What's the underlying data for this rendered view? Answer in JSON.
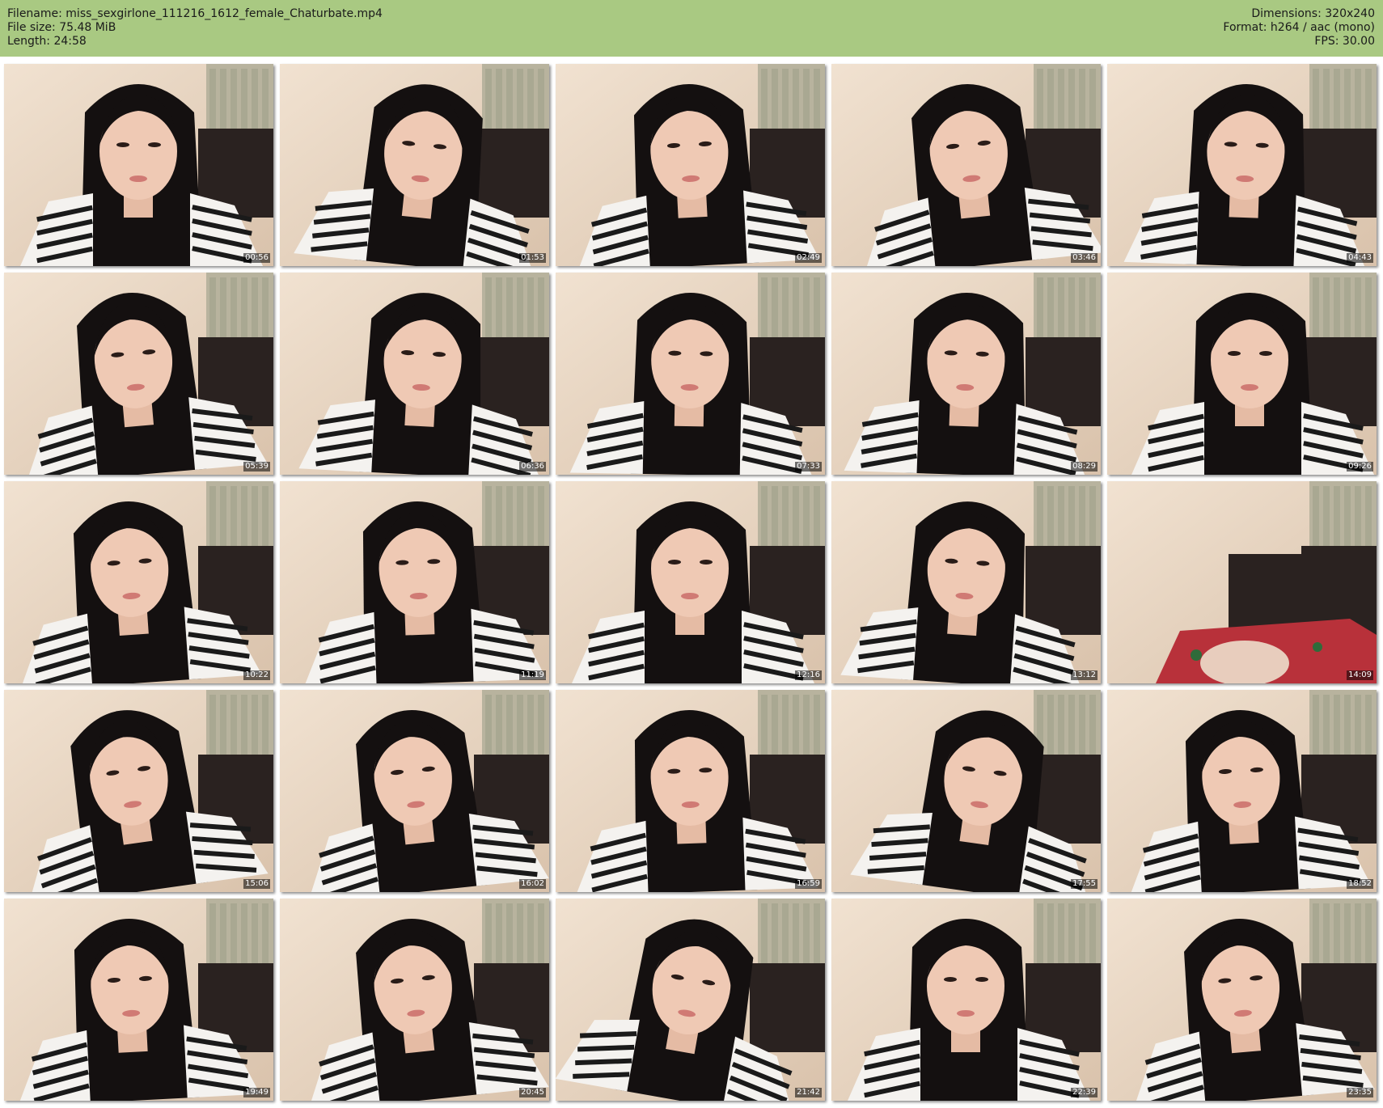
{
  "header": {
    "filename": "Filename: miss_sexgirlone_111216_1612_female_Chaturbate.mp4",
    "filesize": "File size: 75.48 MiB",
    "length": "Length: 24:58",
    "dimensions": "Dimensions: 320x240",
    "format": "Format: h264 / aac (mono)",
    "fps": "FPS: 30.00"
  },
  "frames": [
    {
      "time": "00:56"
    },
    {
      "time": "01:53"
    },
    {
      "time": "02:49"
    },
    {
      "time": "03:46"
    },
    {
      "time": "04:43"
    },
    {
      "time": "05:39"
    },
    {
      "time": "06:36"
    },
    {
      "time": "07:33"
    },
    {
      "time": "08:29"
    },
    {
      "time": "09:26"
    },
    {
      "time": "10:22"
    },
    {
      "time": "11:19"
    },
    {
      "time": "12:16"
    },
    {
      "time": "13:12"
    },
    {
      "time": "14:09"
    },
    {
      "time": "15:06"
    },
    {
      "time": "16:02"
    },
    {
      "time": "16:59"
    },
    {
      "time": "17:55"
    },
    {
      "time": "18:52"
    },
    {
      "time": "19:49"
    },
    {
      "time": "20:45"
    },
    {
      "time": "21:42"
    },
    {
      "time": "22:39"
    },
    {
      "time": "23:35"
    }
  ]
}
